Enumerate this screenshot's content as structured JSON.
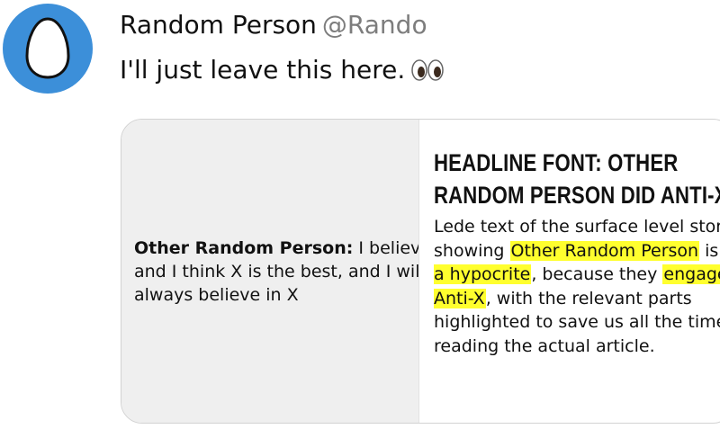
{
  "author": {
    "display_name": "Random Person",
    "handle": "@Rando",
    "avatar_color": "#3c8fd9"
  },
  "tweet": {
    "text": "I'll just leave this here.",
    "emoji_icon": "eyes-icon"
  },
  "card": {
    "quote": {
      "speaker": "Other Random Person:",
      "text": "I believe X and I think X is the best, and I will always believe in X"
    },
    "article": {
      "headline": "HEADLINE FONT: OTHER RANDOM PERSON DID ANTI-X",
      "lede_1": "Lede text of the surface level story showing ",
      "highlight_1": "Other Random Person",
      "lede_2": " is ",
      "highlight_2": "now a hypocrite",
      "lede_3": ", because they ",
      "highlight_3": "engaged in Anti-X",
      "lede_4": ", with the relevant parts highlighted to save us all the time of reading the actual article.",
      "highlight_color": "#ffff2e"
    }
  }
}
